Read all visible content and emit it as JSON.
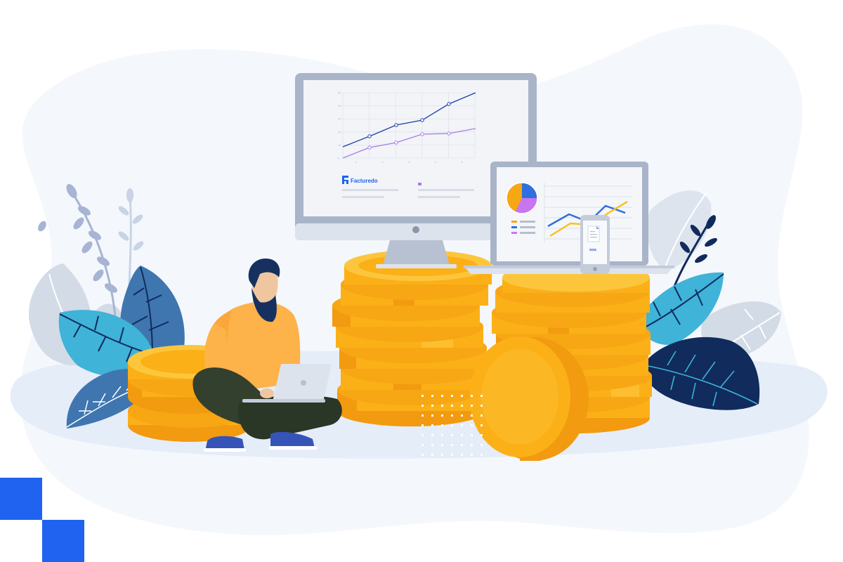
{
  "brand": {
    "name": "Facturedo"
  },
  "colors": {
    "accent": "#1f63f0",
    "coin": "#fbb018",
    "coin_light": "#fcc63c",
    "coin_dark": "#f29a10",
    "leaf_teal": "#3fb3d8",
    "leaf_navy": "#102b5c",
    "leaf_blue": "#3f76b0",
    "leaf_gray": "#ccd4e0",
    "blob": "#f4f7fc",
    "floor": "#e5edf9",
    "monitor": "#a9b4c8",
    "shirt": "#fdb24a",
    "pants": "#33402d",
    "shoe": "#3654b8"
  },
  "monitor_chart": {
    "y_ticks": [
      "50",
      "40",
      "30",
      "20",
      "10",
      "0"
    ],
    "x_ticks": [
      "1",
      "2",
      "3",
      "4",
      "5"
    ]
  },
  "phone": {
    "amount": "$$$$"
  }
}
